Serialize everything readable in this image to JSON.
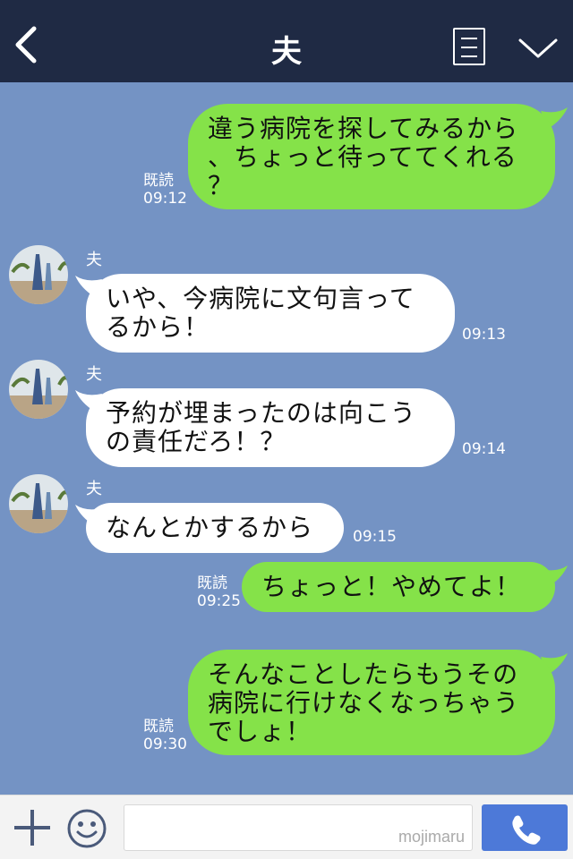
{
  "header": {
    "title": "夫",
    "icons": [
      "back-icon",
      "menu-icon",
      "chevron-down-icon"
    ]
  },
  "messages": [
    {
      "from": "me",
      "lines": [
        "違う病院を探してみるから",
        "、ちょっと待っててくれる",
        "？"
      ],
      "read": "既読",
      "time": "09:12"
    },
    {
      "from": "them",
      "sender": "夫",
      "lines": [
        "いや、今病院に文句言って",
        "るから！"
      ],
      "time": "09:13"
    },
    {
      "from": "them",
      "sender": "夫",
      "lines": [
        "予約が埋まったのは向こう",
        "の責任だろ！？"
      ],
      "time": "09:14"
    },
    {
      "from": "them",
      "sender": "夫",
      "lines": [
        "なんとかするから"
      ],
      "time": "09:15"
    },
    {
      "from": "me",
      "lines": [
        "ちょっと！やめてよ！"
      ],
      "read": "既読",
      "time": "09:25"
    },
    {
      "from": "me",
      "lines": [
        "そんなことしたらもうその",
        "病院に行けなくなっちゃう",
        "でしょ！"
      ],
      "read": "既読",
      "time": "09:30"
    }
  ],
  "footer": {
    "watermark": "mojimaru",
    "icons": [
      "plus-icon",
      "emoji-icon",
      "phone-icon"
    ]
  },
  "colors": {
    "header": "#1f2a44",
    "background": "#7493c4",
    "my_bubble": "#85e249",
    "their_bubble": "#ffffff",
    "call_button": "#4d79d8"
  }
}
